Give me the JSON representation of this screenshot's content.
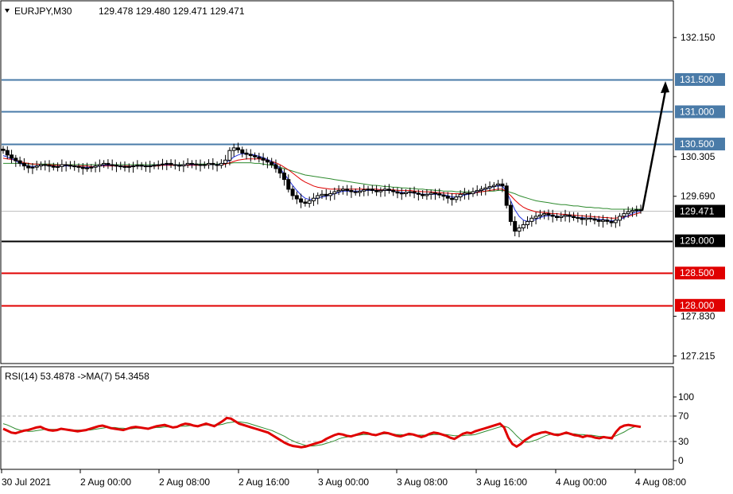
{
  "window": {
    "symbol_label": "EURJPY,M30",
    "ohlc": "129.478 129.480 129.471 129.471"
  },
  "chart_data": [
    {
      "type": "candlestick",
      "title": "EURJPY,M30",
      "ylim": [
        127.0,
        132.5
      ],
      "y_ticks": [
        "132.150",
        "130.305",
        "129.690",
        "127.830",
        "127.215"
      ],
      "x_ticks": [
        "30 Jul 2021",
        "2 Aug 00:00",
        "2 Aug 08:00",
        "2 Aug 16:00",
        "3 Aug 00:00",
        "3 Aug 08:00",
        "3 Aug 16:00",
        "4 Aug 00:00",
        "4 Aug 08:00"
      ],
      "closes": [
        130.4,
        130.33,
        130.28,
        130.24,
        130.2,
        130.16,
        130.13,
        130.14,
        130.16,
        130.18,
        130.17,
        130.16,
        130.14,
        130.15,
        130.18,
        130.17,
        130.16,
        130.15,
        130.14,
        130.12,
        130.13,
        130.14,
        130.16,
        130.18,
        130.2,
        130.18,
        130.17,
        130.16,
        130.15,
        130.14,
        130.15,
        130.16,
        130.17,
        130.16,
        130.15,
        130.16,
        130.17,
        130.18,
        130.19,
        130.2,
        130.18,
        130.17,
        130.16,
        130.18,
        130.2,
        130.19,
        130.18,
        130.17,
        130.18,
        130.2,
        130.18,
        130.17,
        130.2,
        130.25,
        130.4,
        130.44,
        130.41,
        130.36,
        130.34,
        130.32,
        130.3,
        130.28,
        130.25,
        130.22,
        130.18,
        130.12,
        130.05,
        129.95,
        129.8,
        129.7,
        129.65,
        129.6,
        129.58,
        129.62,
        129.66,
        129.7,
        129.72,
        129.7,
        129.73,
        129.76,
        129.78,
        129.8,
        129.78,
        129.76,
        129.75,
        129.77,
        129.79,
        129.8,
        129.78,
        129.76,
        129.78,
        129.8,
        129.78,
        129.76,
        129.74,
        129.73,
        129.75,
        129.76,
        129.74,
        129.72,
        129.7,
        129.72,
        129.74,
        129.73,
        129.71,
        129.69,
        129.66,
        129.64,
        129.68,
        129.72,
        129.74,
        129.73,
        129.76,
        129.78,
        129.8,
        129.82,
        129.84,
        129.86,
        129.88,
        129.85,
        129.55,
        129.3,
        129.15,
        129.2,
        129.25,
        129.3,
        129.35,
        129.38,
        129.4,
        129.42,
        129.4,
        129.38,
        129.36,
        129.38,
        129.4,
        129.38,
        129.36,
        129.35,
        129.33,
        129.35,
        129.34,
        129.32,
        129.3,
        129.32,
        129.3,
        129.28,
        129.32,
        129.38,
        129.42,
        129.45,
        129.47,
        129.48,
        129.47
      ],
      "ma_fast_blue": [
        130.32,
        130.3,
        130.27,
        130.24,
        130.2,
        130.18,
        130.16,
        130.15,
        130.16,
        130.17,
        130.17,
        130.16,
        130.15,
        130.15,
        130.16,
        130.16,
        130.16,
        130.16,
        130.15,
        130.14,
        130.14,
        130.14,
        130.15,
        130.16,
        130.17,
        130.17,
        130.17,
        130.16,
        130.16,
        130.15,
        130.15,
        130.16,
        130.16,
        130.16,
        130.16,
        130.16,
        130.17,
        130.17,
        130.18,
        130.18,
        130.18,
        130.18,
        130.17,
        130.17,
        130.18,
        130.18,
        130.18,
        130.18,
        130.18,
        130.18,
        130.18,
        130.18,
        130.19,
        130.21,
        130.25,
        130.3,
        130.33,
        130.35,
        130.35,
        130.34,
        130.33,
        130.31,
        130.29,
        130.26,
        130.23,
        130.18,
        130.12,
        130.04,
        129.95,
        129.86,
        129.78,
        129.71,
        129.66,
        129.64,
        129.64,
        129.66,
        129.68,
        129.69,
        129.71,
        129.73,
        129.75,
        129.77,
        129.77,
        129.77,
        129.77,
        129.77,
        129.78,
        129.78,
        129.78,
        129.78,
        129.78,
        129.78,
        129.78,
        129.77,
        129.76,
        129.75,
        129.75,
        129.75,
        129.74,
        129.73,
        129.72,
        129.72,
        129.72,
        129.72,
        129.72,
        129.71,
        129.7,
        129.68,
        129.68,
        129.69,
        129.71,
        129.72,
        129.74,
        129.76,
        129.78,
        129.8,
        129.82,
        129.84,
        129.85,
        129.85,
        129.76,
        129.62,
        129.48,
        129.38,
        129.32,
        129.3,
        129.31,
        129.33,
        129.36,
        129.38,
        129.39,
        129.39,
        129.38,
        129.38,
        129.38,
        129.38,
        129.37,
        129.36,
        129.36,
        129.35,
        129.35,
        129.34,
        129.33,
        129.33,
        129.32,
        129.31,
        129.31,
        129.33,
        129.36,
        129.39,
        129.42,
        129.45,
        129.46
      ],
      "ma_mid_red": [
        130.28,
        130.27,
        130.26,
        130.25,
        130.23,
        130.21,
        130.2,
        130.19,
        130.19,
        130.18,
        130.18,
        130.18,
        130.17,
        130.17,
        130.17,
        130.17,
        130.17,
        130.16,
        130.16,
        130.16,
        130.16,
        130.15,
        130.15,
        130.16,
        130.16,
        130.16,
        130.16,
        130.16,
        130.16,
        130.16,
        130.16,
        130.16,
        130.16,
        130.16,
        130.16,
        130.16,
        130.16,
        130.16,
        130.17,
        130.17,
        130.17,
        130.17,
        130.17,
        130.17,
        130.17,
        130.17,
        130.17,
        130.17,
        130.17,
        130.18,
        130.18,
        130.18,
        130.18,
        130.19,
        130.21,
        130.23,
        130.25,
        130.26,
        130.27,
        130.27,
        130.27,
        130.27,
        130.26,
        130.25,
        130.23,
        130.21,
        130.18,
        130.14,
        130.1,
        130.05,
        130.0,
        129.95,
        129.91,
        129.88,
        129.85,
        129.83,
        129.82,
        129.81,
        129.8,
        129.8,
        129.8,
        129.8,
        129.8,
        129.8,
        129.8,
        129.8,
        129.8,
        129.8,
        129.8,
        129.8,
        129.79,
        129.79,
        129.79,
        129.79,
        129.78,
        129.78,
        129.78,
        129.78,
        129.77,
        129.77,
        129.76,
        129.76,
        129.76,
        129.75,
        129.75,
        129.74,
        129.74,
        129.73,
        129.73,
        129.73,
        129.73,
        129.74,
        129.74,
        129.75,
        129.76,
        129.77,
        129.78,
        129.79,
        129.8,
        129.8,
        129.76,
        129.7,
        129.63,
        129.57,
        129.52,
        129.49,
        129.47,
        129.45,
        129.44,
        129.44,
        129.43,
        129.42,
        129.42,
        129.41,
        129.41,
        129.4,
        129.4,
        129.39,
        129.39,
        129.38,
        129.38,
        129.37,
        129.37,
        129.36,
        129.36,
        129.35,
        129.35,
        129.36,
        129.37,
        129.38,
        129.4,
        129.42,
        129.44
      ],
      "ma_slow_green": [
        130.2,
        130.2,
        130.2,
        130.2,
        130.2,
        130.2,
        130.19,
        130.19,
        130.19,
        130.19,
        130.19,
        130.19,
        130.19,
        130.18,
        130.18,
        130.18,
        130.18,
        130.18,
        130.18,
        130.18,
        130.18,
        130.18,
        130.18,
        130.18,
        130.18,
        130.18,
        130.18,
        130.18,
        130.18,
        130.18,
        130.18,
        130.18,
        130.18,
        130.18,
        130.18,
        130.18,
        130.18,
        130.18,
        130.18,
        130.18,
        130.18,
        130.18,
        130.18,
        130.18,
        130.18,
        130.19,
        130.19,
        130.19,
        130.19,
        130.19,
        130.19,
        130.19,
        130.19,
        130.2,
        130.2,
        130.21,
        130.21,
        130.21,
        130.21,
        130.21,
        130.2,
        130.2,
        130.19,
        130.18,
        130.17,
        130.16,
        130.14,
        130.12,
        130.1,
        130.08,
        130.06,
        130.04,
        130.02,
        130.01,
        130.0,
        129.99,
        129.98,
        129.97,
        129.96,
        129.95,
        129.94,
        129.93,
        129.92,
        129.91,
        129.9,
        129.89,
        129.88,
        129.87,
        129.86,
        129.86,
        129.85,
        129.84,
        129.84,
        129.83,
        129.83,
        129.82,
        129.82,
        129.81,
        129.81,
        129.8,
        129.8,
        129.79,
        129.79,
        129.78,
        129.78,
        129.77,
        129.77,
        129.77,
        129.76,
        129.76,
        129.76,
        129.76,
        129.76,
        129.76,
        129.76,
        129.77,
        129.77,
        129.77,
        129.78,
        129.78,
        129.77,
        129.75,
        129.73,
        129.7,
        129.68,
        129.66,
        129.64,
        129.62,
        129.61,
        129.6,
        129.59,
        129.58,
        129.57,
        129.56,
        129.56,
        129.55,
        129.54,
        129.54,
        129.53,
        129.52,
        129.52,
        129.51,
        129.51,
        129.5,
        129.5,
        129.49,
        129.49,
        129.49,
        129.49,
        129.49,
        129.49,
        129.49,
        129.49
      ],
      "arrow": {
        "from": 129.471,
        "to": 131.5
      },
      "current_price": "129.471",
      "horizontal_levels": [
        {
          "label": "131.500",
          "value": 131.5,
          "color": "#4a7ba8"
        },
        {
          "label": "131.000",
          "value": 131.0,
          "color": "#4a7ba8"
        },
        {
          "label": "130.500",
          "value": 130.5,
          "color": "#4a7ba8"
        },
        {
          "label": "129.000",
          "value": 129.0,
          "color": "#000000"
        },
        {
          "label": "128.500",
          "value": 128.5,
          "color": "#e00000"
        },
        {
          "label": "128.000",
          "value": 128.0,
          "color": "#e00000"
        }
      ]
    },
    {
      "type": "line",
      "title": "RSI(14) 53.4878 ->MA(7) 54.3458",
      "ylim": [
        0,
        100
      ],
      "y_ticks": [
        "100",
        "70",
        "30",
        "0"
      ],
      "levels": [
        70,
        30
      ],
      "series": [
        {
          "name": "RSI(14)",
          "color": "#e00000",
          "values": [
            50,
            47,
            44,
            43,
            45,
            47,
            48,
            50,
            52,
            53,
            50,
            48,
            47,
            48,
            50,
            49,
            48,
            47,
            46,
            47,
            48,
            50,
            52,
            54,
            55,
            53,
            51,
            50,
            49,
            48,
            50,
            52,
            53,
            52,
            51,
            50,
            52,
            54,
            55,
            56,
            54,
            52,
            53,
            56,
            58,
            57,
            55,
            54,
            56,
            58,
            56,
            54,
            58,
            62,
            67,
            66,
            62,
            58,
            56,
            54,
            52,
            50,
            48,
            46,
            44,
            40,
            36,
            32,
            28,
            25,
            23,
            22,
            21,
            22,
            24,
            26,
            28,
            30,
            34,
            37,
            40,
            42,
            41,
            39,
            38,
            40,
            42,
            44,
            43,
            41,
            40,
            42,
            44,
            43,
            41,
            39,
            38,
            40,
            42,
            41,
            39,
            37,
            39,
            42,
            44,
            43,
            41,
            39,
            36,
            34,
            38,
            42,
            44,
            43,
            46,
            48,
            50,
            52,
            54,
            56,
            58,
            52,
            36,
            26,
            22,
            26,
            32,
            36,
            40,
            42,
            44,
            45,
            43,
            41,
            40,
            42,
            44,
            42,
            40,
            39,
            37,
            39,
            38,
            36,
            35,
            37,
            36,
            35,
            45,
            52,
            55,
            56,
            55,
            54,
            53
          ]
        },
        {
          "name": "MA(7)",
          "color": "#2e8b2e",
          "values": [
            58,
            56,
            53,
            50,
            48,
            47,
            46,
            46,
            47,
            48,
            49,
            49,
            49,
            49,
            49,
            49,
            49,
            48,
            48,
            48,
            48,
            48,
            49,
            50,
            51,
            52,
            52,
            52,
            51,
            51,
            50,
            50,
            51,
            51,
            51,
            51,
            51,
            52,
            52,
            53,
            53,
            53,
            53,
            54,
            54,
            55,
            55,
            55,
            55,
            56,
            56,
            56,
            56,
            57,
            59,
            60,
            61,
            61,
            60,
            59,
            57,
            55,
            53,
            51,
            49,
            47,
            44,
            41,
            38,
            34,
            31,
            28,
            26,
            24,
            23,
            23,
            24,
            25,
            27,
            29,
            31,
            34,
            36,
            37,
            38,
            39,
            40,
            41,
            41,
            41,
            41,
            41,
            42,
            42,
            42,
            41,
            41,
            40,
            40,
            40,
            40,
            40,
            40,
            40,
            41,
            41,
            41,
            41,
            40,
            39,
            39,
            39,
            40,
            40,
            41,
            43,
            45,
            47,
            49,
            51,
            53,
            54,
            52,
            46,
            39,
            33,
            29,
            29,
            31,
            33,
            36,
            39,
            41,
            42,
            42,
            42,
            42,
            42,
            42,
            41,
            41,
            40,
            40,
            39,
            38,
            38,
            37,
            37,
            39,
            42,
            45,
            49,
            52,
            54,
            54
          ]
        }
      ]
    }
  ]
}
